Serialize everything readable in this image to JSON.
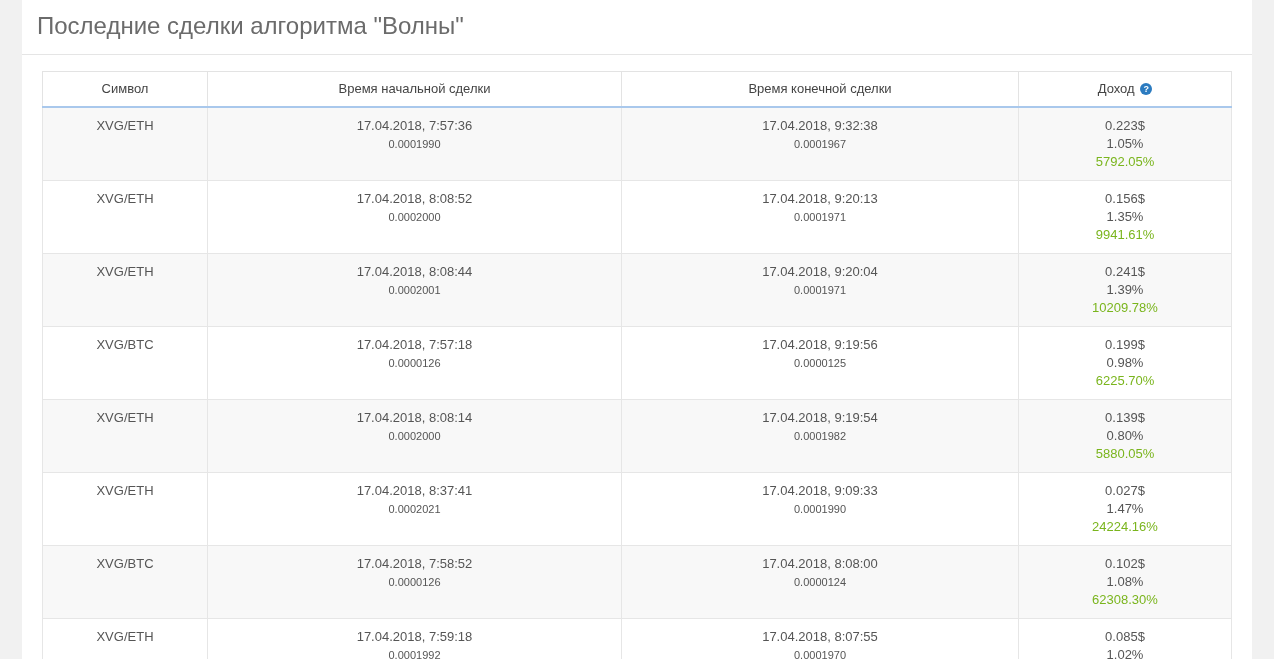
{
  "title": "Последние сделки алгоритма \"Волны\"",
  "table": {
    "columns": [
      {
        "label": "Символ"
      },
      {
        "label": "Время начальной сделки"
      },
      {
        "label": "Время конечной сделки"
      },
      {
        "label": "Доход",
        "help": "?"
      }
    ],
    "rows": [
      {
        "symbol": "XVG/ETH",
        "open_time": "17.04.2018, 7:57:36",
        "open_price": "0.0001990",
        "close_time": "17.04.2018, 9:32:38",
        "close_price": "0.0001967",
        "profit_usd": "0.223$",
        "profit_pct": "1.05%",
        "gain_pct": "5792.05%"
      },
      {
        "symbol": "XVG/ETH",
        "open_time": "17.04.2018, 8:08:52",
        "open_price": "0.0002000",
        "close_time": "17.04.2018, 9:20:13",
        "close_price": "0.0001971",
        "profit_usd": "0.156$",
        "profit_pct": "1.35%",
        "gain_pct": "9941.61%"
      },
      {
        "symbol": "XVG/ETH",
        "open_time": "17.04.2018, 8:08:44",
        "open_price": "0.0002001",
        "close_time": "17.04.2018, 9:20:04",
        "close_price": "0.0001971",
        "profit_usd": "0.241$",
        "profit_pct": "1.39%",
        "gain_pct": "10209.78%"
      },
      {
        "symbol": "XVG/BTC",
        "open_time": "17.04.2018, 7:57:18",
        "open_price": "0.0000126",
        "close_time": "17.04.2018, 9:19:56",
        "close_price": "0.0000125",
        "profit_usd": "0.199$",
        "profit_pct": "0.98%",
        "gain_pct": "6225.70%"
      },
      {
        "symbol": "XVG/ETH",
        "open_time": "17.04.2018, 8:08:14",
        "open_price": "0.0002000",
        "close_time": "17.04.2018, 9:19:54",
        "close_price": "0.0001982",
        "profit_usd": "0.139$",
        "profit_pct": "0.80%",
        "gain_pct": "5880.05%"
      },
      {
        "symbol": "XVG/ETH",
        "open_time": "17.04.2018, 8:37:41",
        "open_price": "0.0002021",
        "close_time": "17.04.2018, 9:09:33",
        "close_price": "0.0001990",
        "profit_usd": "0.027$",
        "profit_pct": "1.47%",
        "gain_pct": "24224.16%"
      },
      {
        "symbol": "XVG/BTC",
        "open_time": "17.04.2018, 7:58:52",
        "open_price": "0.0000126",
        "close_time": "17.04.2018, 8:08:00",
        "close_price": "0.0000124",
        "profit_usd": "0.102$",
        "profit_pct": "1.08%",
        "gain_pct": "62308.30%"
      },
      {
        "symbol": "XVG/ETH",
        "open_time": "17.04.2018, 7:59:18",
        "open_price": "0.0001992",
        "close_time": "17.04.2018, 8:07:55",
        "close_price": "0.0001970",
        "profit_usd": "0.085$",
        "profit_pct": "1.02%"
      }
    ]
  }
}
